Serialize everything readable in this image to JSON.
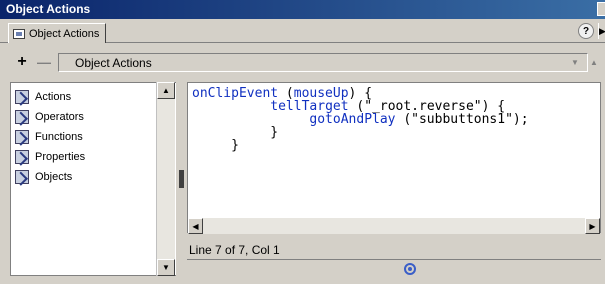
{
  "window": {
    "title": "Object Actions"
  },
  "tab": {
    "label": "Object Actions"
  },
  "toolbar": {
    "dropdown_value": "Object Actions"
  },
  "sidebar": {
    "items": [
      {
        "label": "Actions",
        "icon": "book-icon"
      },
      {
        "label": "Operators",
        "icon": "book-icon"
      },
      {
        "label": "Functions",
        "icon": "book-icon"
      },
      {
        "label": "Properties",
        "icon": "book-icon"
      },
      {
        "label": "Objects",
        "icon": "book-icon"
      }
    ]
  },
  "editor": {
    "lines": [
      {
        "indent": "",
        "parts": [
          {
            "t": "onClipEvent",
            "kw": true
          },
          {
            "t": " ("
          },
          {
            "t": "mouseUp",
            "kw": true
          },
          {
            "t": ") {"
          }
        ]
      },
      {
        "indent": "          ",
        "parts": [
          {
            "t": "tellTarget",
            "kw": true
          },
          {
            "t": " (\"_root.reverse\") {"
          }
        ]
      },
      {
        "indent": "               ",
        "parts": [
          {
            "t": "gotoAndPlay",
            "kw": true
          },
          {
            "t": " (\"subbuttons1\");"
          }
        ]
      },
      {
        "indent": "          ",
        "parts": [
          {
            "t": "}"
          }
        ]
      },
      {
        "indent": "     ",
        "parts": [
          {
            "t": "}"
          }
        ]
      }
    ]
  },
  "status": {
    "text": "Line 7 of 7, Col 1"
  },
  "colors": {
    "keyword": "#1030c0",
    "titlebar": "#0a246a",
    "face": "#d4d0c8"
  }
}
